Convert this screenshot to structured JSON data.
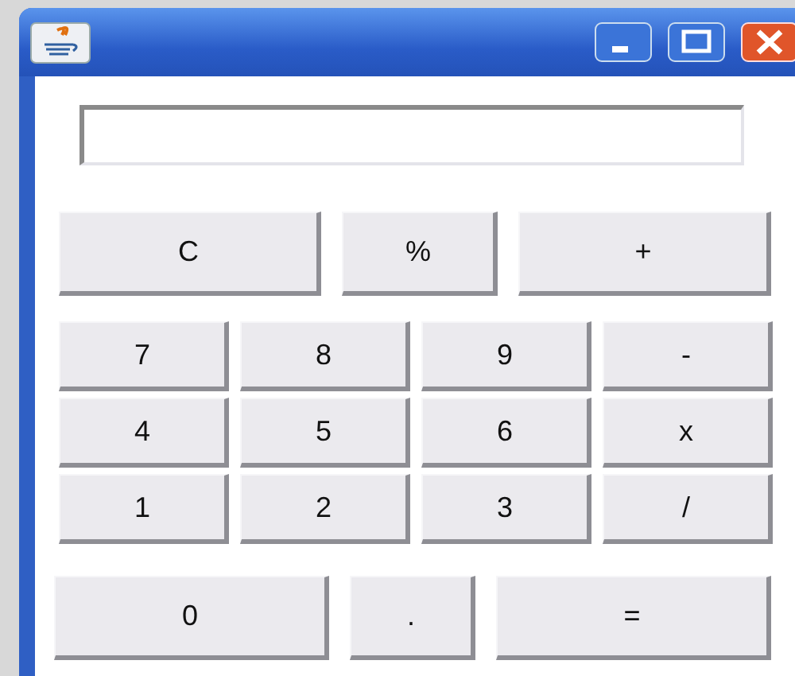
{
  "keypad": [
    {
      "kind": "top",
      "keys": [
        "C",
        "%",
        "+"
      ]
    },
    {
      "kind": "grid",
      "keys": [
        "7",
        "8",
        "9",
        "-"
      ]
    },
    {
      "kind": "grid",
      "keys": [
        "4",
        "5",
        "6",
        "x"
      ]
    },
    {
      "kind": "grid",
      "keys": [
        "1",
        "2",
        "3",
        "/"
      ]
    },
    {
      "kind": "bottom",
      "keys": [
        "0",
        ".",
        "="
      ]
    }
  ]
}
